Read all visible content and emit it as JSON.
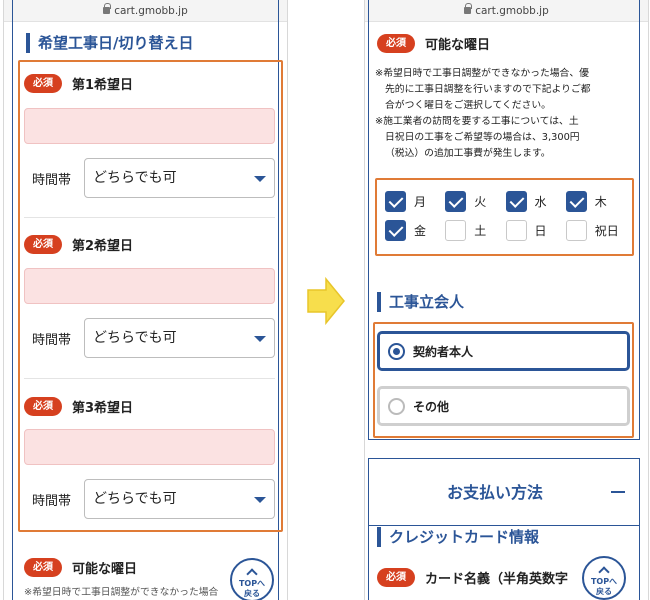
{
  "left_screen": {
    "url": "cart.gmobb.jp",
    "section_title": "希望工事日/切り替え日",
    "preferences": [
      {
        "badge": "必須",
        "label": "第1希望日",
        "time_label": "時間帯",
        "time_value": "どちらでも可"
      },
      {
        "badge": "必須",
        "label": "第2希望日",
        "time_label": "時間帯",
        "time_value": "どちらでも可"
      },
      {
        "badge": "必須",
        "label": "第3希望日",
        "time_label": "時間帯",
        "time_value": "どちらでも可"
      }
    ],
    "available_days": {
      "badge": "必須",
      "label": "可能な曜日"
    },
    "cut_note": "※希望日時で工事日調整ができなかった場合",
    "top_button": "TOPへ\n戻る"
  },
  "right_screen": {
    "url": "cart.gmobb.jp",
    "available_days": {
      "badge": "必須",
      "label": "可能な曜日",
      "notes": [
        "※希望日時で工事日調整ができなかった場合、優",
        "先的に工事日調整を行いますので下記よりご都",
        "合がつく曜日をご選択してください。",
        "※施工業者の訪問を要する工事については、土",
        "日祝日の工事をご希望等の場合は、3,300円",
        "（税込）の追加工事費が発生します。"
      ],
      "days": [
        {
          "label": "月",
          "checked": true
        },
        {
          "label": "火",
          "checked": true
        },
        {
          "label": "水",
          "checked": true
        },
        {
          "label": "木",
          "checked": true
        },
        {
          "label": "金",
          "checked": true
        },
        {
          "label": "土",
          "checked": false
        },
        {
          "label": "日",
          "checked": false
        },
        {
          "label": "祝日",
          "checked": false
        }
      ]
    },
    "attendance": {
      "title": "工事立会人",
      "options": [
        {
          "label": "契約者本人",
          "selected": true
        },
        {
          "label": "その他",
          "selected": false
        }
      ]
    },
    "payment": {
      "title": "お支払い方法",
      "credit_title": "クレジットカード情報",
      "card_name": {
        "badge": "必須",
        "label": "カード名義（半角英数字"
      }
    },
    "top_button": "TOPへ\n戻る"
  },
  "colors": {
    "accent": "#2b5597",
    "highlight": "#e07b36",
    "required": "#d6401f",
    "arrow": "#f7de4c"
  }
}
